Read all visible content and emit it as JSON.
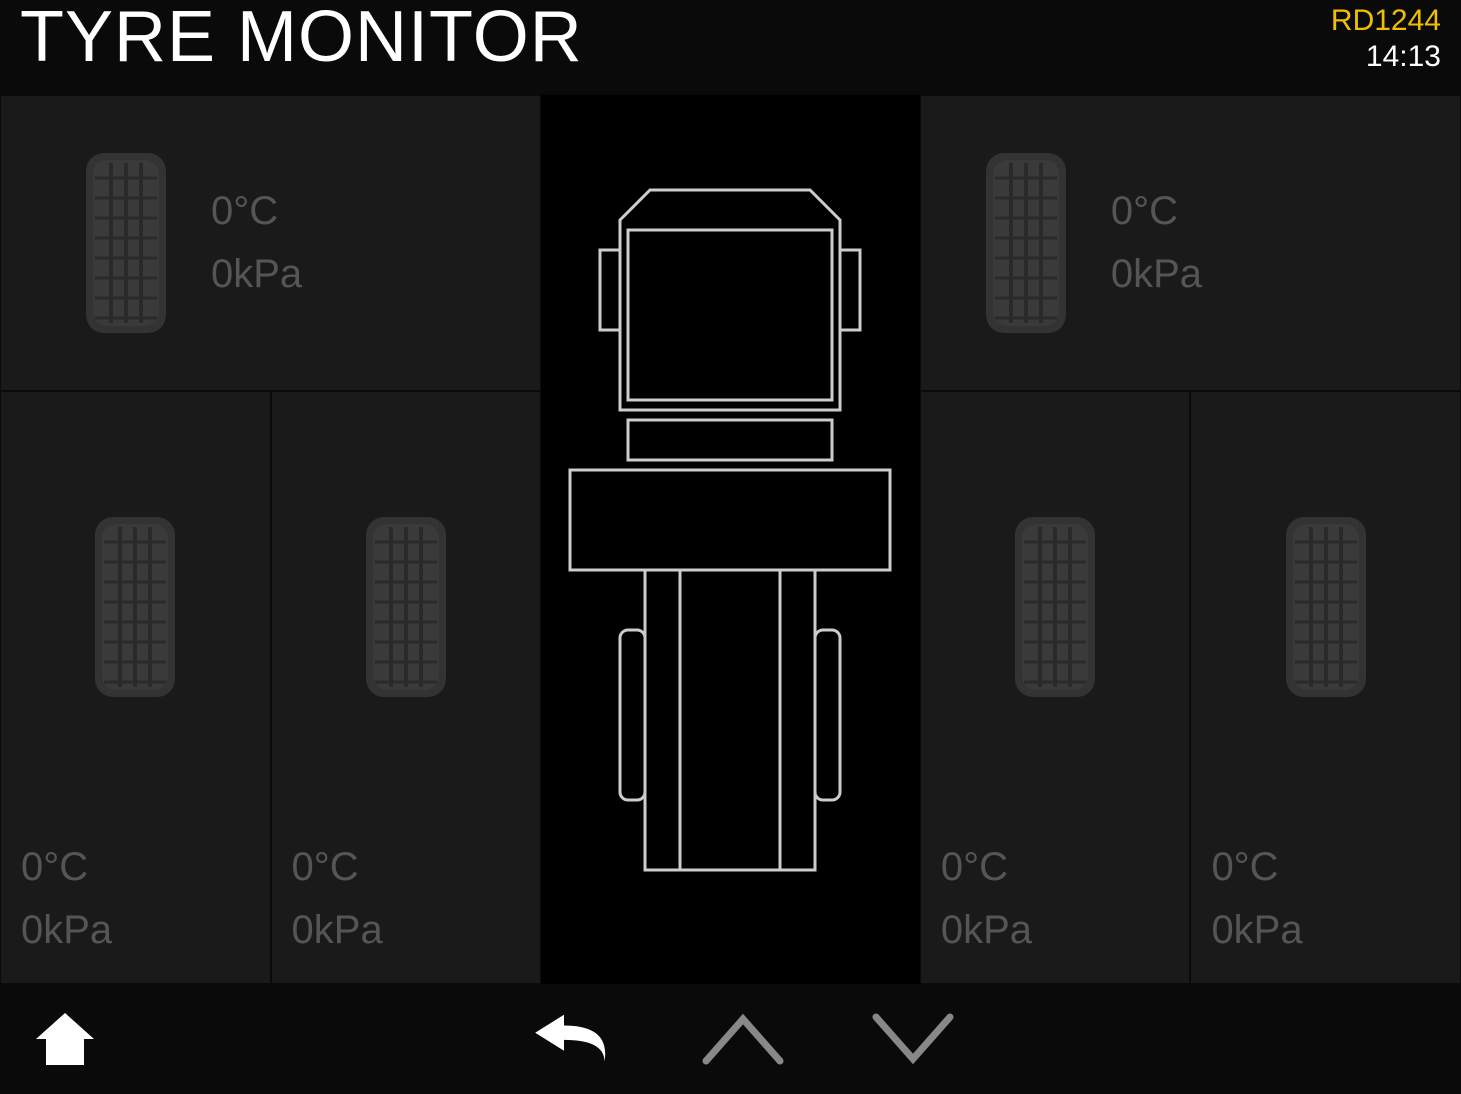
{
  "header": {
    "title": "TYRE MONITOR",
    "vehicle_id": "RD1244",
    "time": "14:13"
  },
  "tyres": {
    "front_left": {
      "temp": "0°C",
      "pressure": "0kPa"
    },
    "front_right": {
      "temp": "0°C",
      "pressure": "0kPa"
    },
    "rear_outer_left": {
      "temp": "0°C",
      "pressure": "0kPa"
    },
    "rear_inner_left": {
      "temp": "0°C",
      "pressure": "0kPa"
    },
    "rear_inner_right": {
      "temp": "0°C",
      "pressure": "0kPa"
    },
    "rear_outer_right": {
      "temp": "0°C",
      "pressure": "0kPa"
    }
  },
  "nav": {
    "home": "home",
    "back": "back",
    "up": "up",
    "down": "down"
  }
}
